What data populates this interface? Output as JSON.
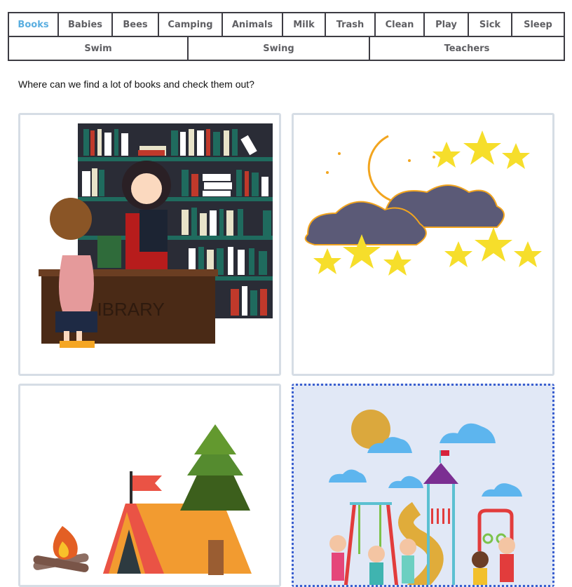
{
  "tabs": {
    "row1": [
      {
        "label": "Books",
        "active": true
      },
      {
        "label": "Babies"
      },
      {
        "label": "Bees"
      },
      {
        "label": "Camping"
      },
      {
        "label": "Animals"
      },
      {
        "label": "Milk"
      },
      {
        "label": "Trash"
      },
      {
        "label": "Clean"
      },
      {
        "label": "Play"
      },
      {
        "label": "Sick"
      },
      {
        "label": "Sleep"
      }
    ],
    "row2": [
      {
        "label": "Swim"
      },
      {
        "label": "Swing"
      },
      {
        "label": "Teachers"
      }
    ]
  },
  "question": "Where can we find a lot of books and check them out?",
  "library_sign": "LIBRARY",
  "options": [
    {
      "id": "library",
      "icon": "library-illustration"
    },
    {
      "id": "night-sky",
      "icon": "moon-clouds-stars-illustration"
    },
    {
      "id": "camping",
      "icon": "tent-campfire-illustration"
    },
    {
      "id": "playground",
      "icon": "playground-illustration",
      "selected": true
    }
  ],
  "colors": {
    "accent": "#5aaee0",
    "selected_border": "#3a5fcf",
    "selected_bg": "#e1e8f6",
    "card_border": "#d6dde5",
    "tab_border": "#3d3c43"
  }
}
